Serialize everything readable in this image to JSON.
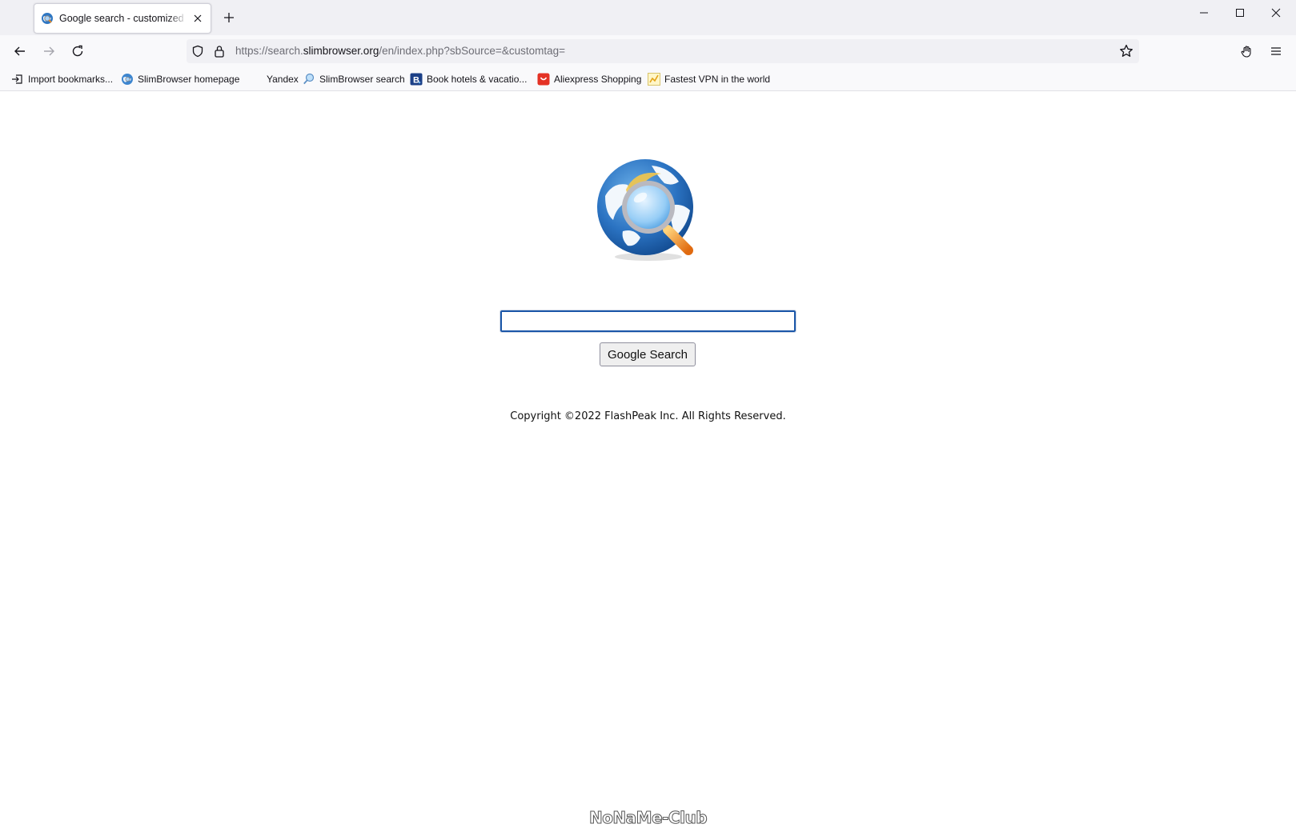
{
  "browser": {
    "tab": {
      "title": "Google search - customized by SlimBrowser",
      "favicon": "globe-search-icon"
    },
    "new_tab_icon": "plus-icon",
    "window_controls": [
      "minimize-icon",
      "maximize-icon",
      "close-icon"
    ],
    "nav": {
      "back_icon": "arrow-left-icon",
      "forward_icon": "arrow-right-icon",
      "reload_icon": "reload-icon"
    },
    "url": {
      "prefix": "https://search.",
      "host": "slimbrowser.org",
      "path": "/en/index.php?sbSource=&customtag="
    },
    "toolbar_icons": [
      "hand-icon",
      "menu-icon"
    ]
  },
  "bookmarks": [
    {
      "label": "Import bookmarks...",
      "icon": "import-icon"
    },
    {
      "label": "SlimBrowser homepage",
      "icon": "globe-icon"
    },
    {
      "label": "Yandex",
      "icon": "blank"
    },
    {
      "label": "SlimBrowser search",
      "icon": "magnifier-icon"
    },
    {
      "label": "Book hotels & vacatio...",
      "icon": "booking-icon"
    },
    {
      "label": "Aliexpress Shopping",
      "icon": "aliexpress-icon"
    },
    {
      "label": "Fastest VPN in the world",
      "icon": "vpn-icon"
    }
  ],
  "page": {
    "search_value": "",
    "search_button": "Google Search",
    "copyright": "Copyright ©2022 FlashPeak Inc. All Rights Reserved.",
    "watermark": "NoNaMe-Club"
  },
  "colors": {
    "accent": "#1a56a8",
    "toolbar_bg": "#f9f9fb",
    "titlebar_bg": "#f0f0f4"
  }
}
